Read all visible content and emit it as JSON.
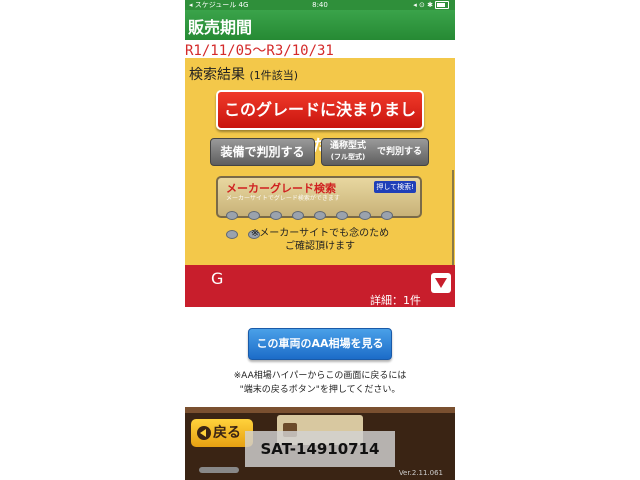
{
  "status_bar": {
    "carrier": "◂ スケジュール",
    "network": "4G",
    "time": "8:40",
    "right_icons": "◂ ⊙ ✱"
  },
  "header": {
    "title": "販売期間"
  },
  "date_range": "R1/11/05〜R3/10/31",
  "results": {
    "label": "検索結果",
    "count": "(1件該当)"
  },
  "buttons": {
    "decide": "このグレードに決まりました",
    "equip": "装備で判別する",
    "type_main": "通称型式",
    "type_sub": "(フル型式)",
    "type_right": "で判別する",
    "aa": "この車両のAA相場を見る",
    "back": "戻る"
  },
  "maker_banner": {
    "title": "メーカーグレード検索",
    "push": "押して検索!",
    "subtitle": "メーカーサイトでグレード検索ができます"
  },
  "note1": {
    "line1": "※メーカーサイトでも念のため",
    "line2": "ご確認頂けます"
  },
  "grade": {
    "name": "G",
    "detail": "詳細：1件"
  },
  "note2": {
    "line1": "※AA相場ハイパーからこの画面に戻るには",
    "line2": "\"端末の戻るボタン\"を押してください。"
  },
  "footer": {
    "watermark": "SAT-14910714",
    "version": "Ver.2.11.061"
  },
  "colors": {
    "header_green": "#2f8f3a",
    "page_yellow": "#f3c84a",
    "decide_red": "#d42a2a",
    "grade_red": "#c81e2c",
    "aa_blue": "#1c6cc8",
    "footer_brown": "#3a2414"
  }
}
